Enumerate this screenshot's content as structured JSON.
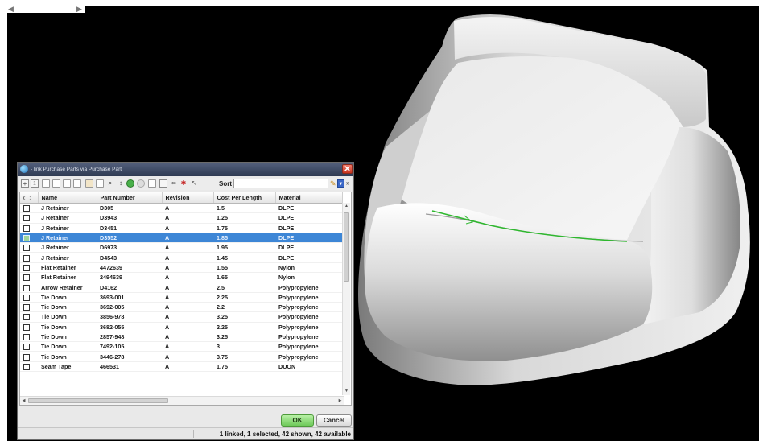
{
  "dialog": {
    "title": "- link Purchase Parts via Purchase Part",
    "close_glyph": "✕",
    "toolbar": {
      "page_field": "1",
      "sort_label": "Sort",
      "sort_value": "",
      "more_glyph": "»"
    },
    "grid": {
      "columns": [
        "",
        "Name",
        "Part Number",
        "Revision",
        "Cost Per Length",
        "Material"
      ],
      "rows": [
        {
          "name": "J Retainer",
          "part_number": "D305",
          "revision": "A",
          "cost_per_length": "1.5",
          "material": "DLPE"
        },
        {
          "name": "J Retainer",
          "part_number": "D3943",
          "revision": "A",
          "cost_per_length": "1.25",
          "material": "DLPE"
        },
        {
          "name": "J Retainer",
          "part_number": "D3451",
          "revision": "A",
          "cost_per_length": "1.75",
          "material": "DLPE"
        },
        {
          "name": "J Retainer",
          "part_number": "D3552",
          "revision": "A",
          "cost_per_length": "1.85",
          "material": "DLPE",
          "selected": true
        },
        {
          "name": "J Retainer",
          "part_number": "D6973",
          "revision": "A",
          "cost_per_length": "1.95",
          "material": "DLPE"
        },
        {
          "name": "J Retainer",
          "part_number": "D4543",
          "revision": "A",
          "cost_per_length": "1.45",
          "material": "DLPE"
        },
        {
          "name": "Flat Retainer",
          "part_number": "4472639",
          "revision": "A",
          "cost_per_length": "1.55",
          "material": "Nylon"
        },
        {
          "name": "Flat Retainer",
          "part_number": "2494639",
          "revision": "A",
          "cost_per_length": "1.65",
          "material": "Nylon"
        },
        {
          "name": "Arrow Retainer",
          "part_number": "D4162",
          "revision": "A",
          "cost_per_length": "2.5",
          "material": "Polypropylene"
        },
        {
          "name": "Tie Down",
          "part_number": "3693-001",
          "revision": "A",
          "cost_per_length": "2.25",
          "material": "Polypropylene"
        },
        {
          "name": "Tie Down",
          "part_number": "3692-005",
          "revision": "A",
          "cost_per_length": "2.2",
          "material": "Polypropylene"
        },
        {
          "name": "Tie Down",
          "part_number": "3856-978",
          "revision": "A",
          "cost_per_length": "3.25",
          "material": "Polypropylene"
        },
        {
          "name": "Tie Down",
          "part_number": "3682-055",
          "revision": "A",
          "cost_per_length": "2.25",
          "material": "Polypropylene"
        },
        {
          "name": "Tie Down",
          "part_number": "2857-948",
          "revision": "A",
          "cost_per_length": "3.25",
          "material": "Polypropylene"
        },
        {
          "name": "Tie Down",
          "part_number": "7492-105",
          "revision": "A",
          "cost_per_length": "3",
          "material": "Polypropylene"
        },
        {
          "name": "Tie Down",
          "part_number": "3446-278",
          "revision": "A",
          "cost_per_length": "3.75",
          "material": "Polypropylene"
        },
        {
          "name": "Seam Tape",
          "part_number": "466531",
          "revision": "A",
          "cost_per_length": "1.75",
          "material": "DUON"
        }
      ]
    },
    "ok_label": "OK",
    "cancel_label": "Cancel",
    "status": "1 linked, 1 selected, 42 shown, 42 available"
  },
  "colors": {
    "viewport_background": "#000000",
    "selection": "#3d86d6",
    "ok_button": "#8ad877",
    "close_button": "#d9452e"
  }
}
